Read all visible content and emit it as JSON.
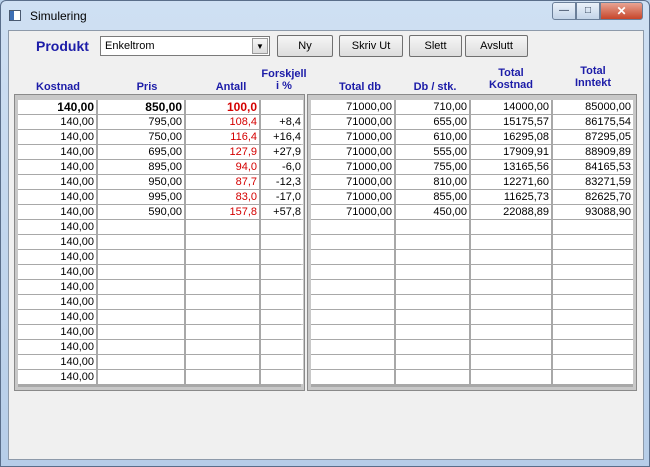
{
  "window": {
    "title": "Simulering"
  },
  "toolbar": {
    "produkt_label": "Produkt",
    "produkt_value": "Enkeltrom",
    "buttons": {
      "ny": "Ny",
      "skriv_ut": "Skriv Ut",
      "slett": "Slett",
      "avslutt": "Avslutt"
    }
  },
  "headers": {
    "kostnad": "Kostnad",
    "pris": "Pris",
    "antall": "Antall",
    "forskjell_1": "Forskjell",
    "forskjell_2": "i %",
    "total_db": "Total db",
    "db_stk": "Db / stk.",
    "total_kostnad_1": "Total",
    "total_kostnad_2": "Kostnad",
    "total_inntekt_1": "Total",
    "total_inntekt_2": "Inntekt"
  },
  "colors": {
    "accent": "#1c1ca8",
    "negative": "#d40000"
  },
  "left_rows": [
    {
      "kostnad": "140,00",
      "pris": "850,00",
      "antall": "100,0",
      "forskjell": ""
    },
    {
      "kostnad": "140,00",
      "pris": "795,00",
      "antall": "108,4",
      "forskjell": "+8,4"
    },
    {
      "kostnad": "140,00",
      "pris": "750,00",
      "antall": "116,4",
      "forskjell": "+16,4"
    },
    {
      "kostnad": "140,00",
      "pris": "695,00",
      "antall": "127,9",
      "forskjell": "+27,9"
    },
    {
      "kostnad": "140,00",
      "pris": "895,00",
      "antall": "94,0",
      "forskjell": "-6,0"
    },
    {
      "kostnad": "140,00",
      "pris": "950,00",
      "antall": "87,7",
      "forskjell": "-12,3"
    },
    {
      "kostnad": "140,00",
      "pris": "995,00",
      "antall": "83,0",
      "forskjell": "-17,0"
    },
    {
      "kostnad": "140,00",
      "pris": "590,00",
      "antall": "157,8",
      "forskjell": "+57,8"
    },
    {
      "kostnad": "140,00",
      "pris": "",
      "antall": "",
      "forskjell": ""
    },
    {
      "kostnad": "140,00",
      "pris": "",
      "antall": "",
      "forskjell": ""
    },
    {
      "kostnad": "140,00",
      "pris": "",
      "antall": "",
      "forskjell": ""
    },
    {
      "kostnad": "140,00",
      "pris": "",
      "antall": "",
      "forskjell": ""
    },
    {
      "kostnad": "140,00",
      "pris": "",
      "antall": "",
      "forskjell": ""
    },
    {
      "kostnad": "140,00",
      "pris": "",
      "antall": "",
      "forskjell": ""
    },
    {
      "kostnad": "140,00",
      "pris": "",
      "antall": "",
      "forskjell": ""
    },
    {
      "kostnad": "140,00",
      "pris": "",
      "antall": "",
      "forskjell": ""
    },
    {
      "kostnad": "140,00",
      "pris": "",
      "antall": "",
      "forskjell": ""
    },
    {
      "kostnad": "140,00",
      "pris": "",
      "antall": "",
      "forskjell": ""
    },
    {
      "kostnad": "140,00",
      "pris": "",
      "antall": "",
      "forskjell": ""
    }
  ],
  "right_rows": [
    {
      "total_db": "71000,00",
      "db_stk": "710,00",
      "total_kostnad": "14000,00",
      "total_inntekt": "85000,00"
    },
    {
      "total_db": "71000,00",
      "db_stk": "655,00",
      "total_kostnad": "15175,57",
      "total_inntekt": "86175,54"
    },
    {
      "total_db": "71000,00",
      "db_stk": "610,00",
      "total_kostnad": "16295,08",
      "total_inntekt": "87295,05"
    },
    {
      "total_db": "71000,00",
      "db_stk": "555,00",
      "total_kostnad": "17909,91",
      "total_inntekt": "88909,89"
    },
    {
      "total_db": "71000,00",
      "db_stk": "755,00",
      "total_kostnad": "13165,56",
      "total_inntekt": "84165,53"
    },
    {
      "total_db": "71000,00",
      "db_stk": "810,00",
      "total_kostnad": "12271,60",
      "total_inntekt": "83271,59"
    },
    {
      "total_db": "71000,00",
      "db_stk": "855,00",
      "total_kostnad": "11625,73",
      "total_inntekt": "82625,70"
    },
    {
      "total_db": "71000,00",
      "db_stk": "450,00",
      "total_kostnad": "22088,89",
      "total_inntekt": "93088,90"
    },
    {
      "total_db": "",
      "db_stk": "",
      "total_kostnad": "",
      "total_inntekt": ""
    },
    {
      "total_db": "",
      "db_stk": "",
      "total_kostnad": "",
      "total_inntekt": ""
    },
    {
      "total_db": "",
      "db_stk": "",
      "total_kostnad": "",
      "total_inntekt": ""
    },
    {
      "total_db": "",
      "db_stk": "",
      "total_kostnad": "",
      "total_inntekt": ""
    },
    {
      "total_db": "",
      "db_stk": "",
      "total_kostnad": "",
      "total_inntekt": ""
    },
    {
      "total_db": "",
      "db_stk": "",
      "total_kostnad": "",
      "total_inntekt": ""
    },
    {
      "total_db": "",
      "db_stk": "",
      "total_kostnad": "",
      "total_inntekt": ""
    },
    {
      "total_db": "",
      "db_stk": "",
      "total_kostnad": "",
      "total_inntekt": ""
    },
    {
      "total_db": "",
      "db_stk": "",
      "total_kostnad": "",
      "total_inntekt": ""
    },
    {
      "total_db": "",
      "db_stk": "",
      "total_kostnad": "",
      "total_inntekt": ""
    },
    {
      "total_db": "",
      "db_stk": "",
      "total_kostnad": "",
      "total_inntekt": ""
    }
  ]
}
